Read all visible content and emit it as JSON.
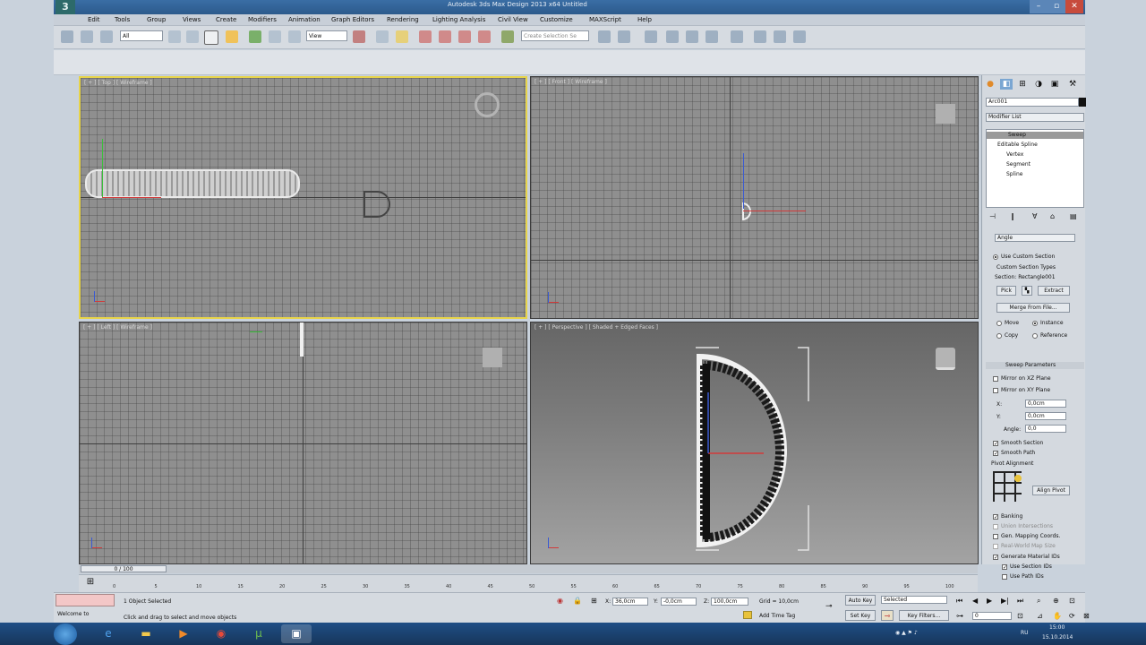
{
  "window": {
    "title": "Autodesk 3ds Max Design 2013 x64    Untitled",
    "logo": "3"
  },
  "menu": [
    "Edit",
    "Tools",
    "Group",
    "Views",
    "Create",
    "Modifiers",
    "Animation",
    "Graph Editors",
    "Rendering",
    "Lighting Analysis",
    "Civil View",
    "Customize",
    "MAXScript",
    "Help"
  ],
  "toolbar": {
    "selection_filter": "All",
    "ref_coord": "View",
    "named_selection": "Create Selection Se"
  },
  "viewports": {
    "top": "[ + ] [ Top ] [ Wireframe ]",
    "front": "[ + ] [ Front ] [ Wireframe ]",
    "left": "[ + ] [ Left ] [ Wireframe ]",
    "perspective": "[ + ] [ Perspective ] [ Shaded + Edged Faces ]"
  },
  "command_panel": {
    "object_name": "Arc001",
    "modifier_list": "Modifier List",
    "stack": [
      "Sweep",
      "Editable Spline",
      "Vertex",
      "Segment",
      "Spline"
    ],
    "angle_dropdown": "Angle",
    "use_custom_section": "Use Custom Section",
    "custom_section_types": "Custom Section Types",
    "section": "Section: Rectangle001",
    "pick": "Pick",
    "extract": "Extract",
    "merge": "Merge From File...",
    "move": "Move",
    "instance": "Instance",
    "copy": "Copy",
    "reference": "Reference",
    "sweep_params": "Sweep Parameters",
    "mirror_xz": "Mirror on XZ Plane",
    "mirror_xy": "Mirror on XY Plane",
    "x_label": "X:",
    "x_value": "0,0cm",
    "y_label": "Y:",
    "y_value": "0,0cm",
    "angle_label": "Angle:",
    "angle_value": "0,0",
    "smooth_section": "Smooth Section",
    "smooth_path": "Smooth Path",
    "pivot_alignment": "Pivot Alignment",
    "align_pivot": "Align Pivot",
    "banking": "Banking",
    "union_intersections": "Union Intersections",
    "gen_mapping": "Gen. Mapping Coords.",
    "real_world": "Real-World Map Size",
    "gen_material": "Generate Material IDs",
    "use_section_ids": "Use Section IDs",
    "use_path_ids": "Use Path IDs"
  },
  "timeline": {
    "frame": "0 / 100",
    "ticks": [
      "0",
      "5",
      "10",
      "15",
      "20",
      "25",
      "30",
      "35",
      "40",
      "45",
      "50",
      "55",
      "60",
      "65",
      "70",
      "75",
      "80",
      "85",
      "90",
      "95",
      "100"
    ]
  },
  "status": {
    "script": "Welcome to",
    "objects": "1 Object Selected",
    "prompt": "Click and drag to select and move objects",
    "x": "36,0cm",
    "y": "-0,0cm",
    "z": "100,0cm",
    "grid": "Grid = 10,0cm",
    "add_time_tag": "Add Time Tag",
    "auto_key": "Auto Key",
    "selected": "Selected",
    "set_key": "Set Key",
    "key_filters": "Key Filters...",
    "frame": "0"
  },
  "taskbar": {
    "lang": "RU",
    "time": "15:00",
    "date": "15.10.2014"
  }
}
